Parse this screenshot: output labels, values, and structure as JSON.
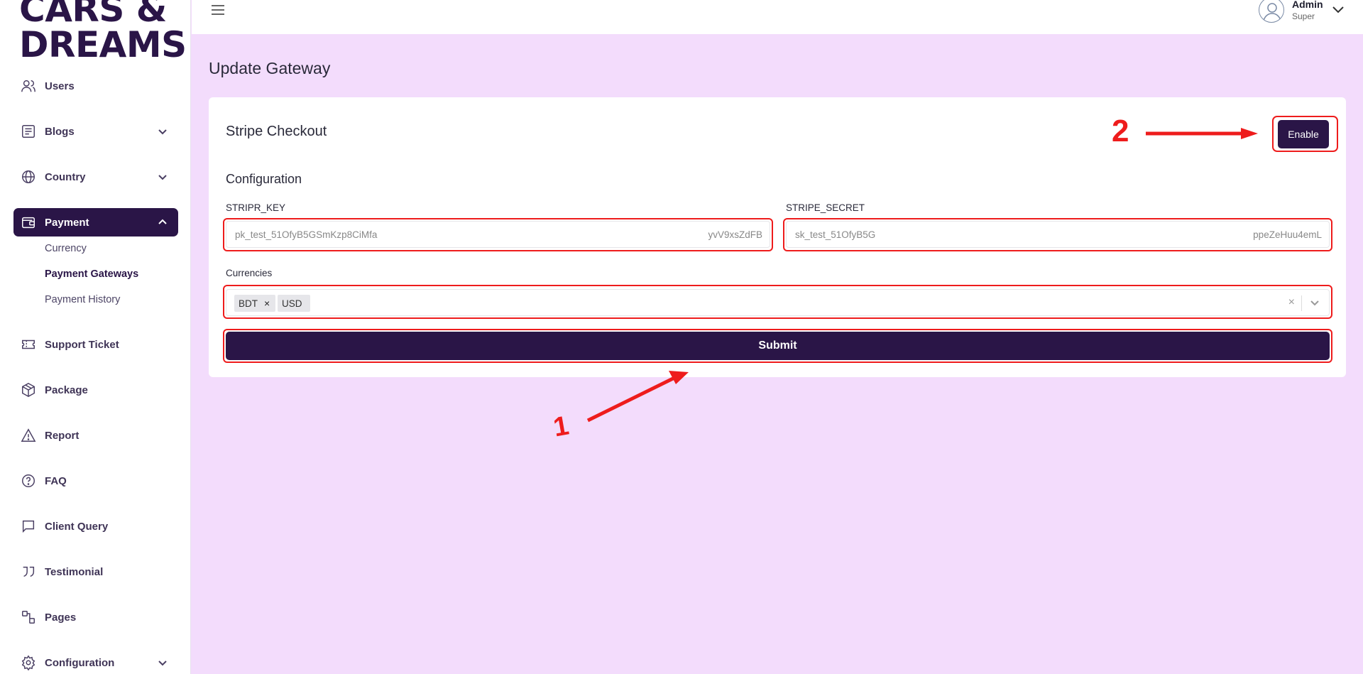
{
  "brand": {
    "line1": "CARS &",
    "line2": "DREAMS"
  },
  "sidebar": {
    "items": [
      {
        "label": "Users"
      },
      {
        "label": "Blogs"
      },
      {
        "label": "Country"
      },
      {
        "label": "Payment"
      },
      {
        "label": "Support Ticket"
      },
      {
        "label": "Package"
      },
      {
        "label": "Report"
      },
      {
        "label": "FAQ"
      },
      {
        "label": "Client Query"
      },
      {
        "label": "Testimonial"
      },
      {
        "label": "Pages"
      },
      {
        "label": "Configuration"
      }
    ],
    "payment_sub": [
      {
        "label": "Currency"
      },
      {
        "label": "Payment Gateways"
      },
      {
        "label": "Payment History"
      }
    ]
  },
  "header": {
    "user_name": "Admin",
    "user_role": "Super"
  },
  "main": {
    "page_title": "Update Gateway",
    "card_title": "Stripe Checkout",
    "enable_label": "Enable",
    "section_title": "Configuration",
    "stripe_key": {
      "label": "STRIPR_KEY",
      "value_start": "pk_test_51OfyB5GSmKzp8CiMfa",
      "value_end": "yvV9xsZdFB"
    },
    "stripe_secret": {
      "label": "STRIPE_SECRET",
      "value_start": "sk_test_51OfyB5G",
      "value_end": "ppeZeHuu4emL"
    },
    "currencies": {
      "label": "Currencies",
      "tags": [
        "BDT",
        "USD"
      ]
    },
    "submit_label": "Submit"
  },
  "annotations": {
    "one": "1",
    "two": "2"
  },
  "colors": {
    "brand": "#2a1547",
    "background": "#f3dcfc",
    "highlight": "#ee1c1c"
  }
}
